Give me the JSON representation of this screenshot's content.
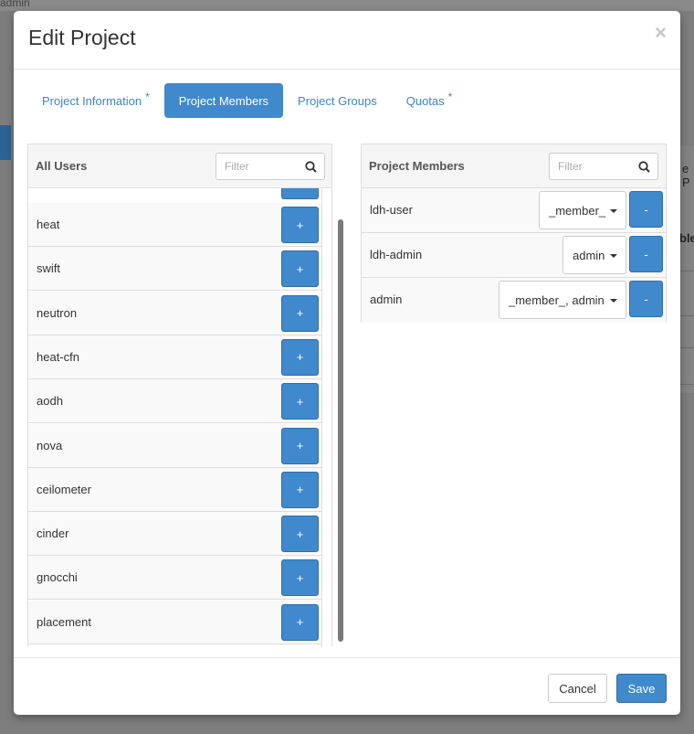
{
  "background": {
    "topbar_text": "admin",
    "right_text_1": "e P",
    "right_text_2": "ble"
  },
  "modal": {
    "title": "Edit Project",
    "close_glyph": "×"
  },
  "tabs": [
    {
      "label": "Project Information",
      "required": "*",
      "active": false
    },
    {
      "label": "Project Members",
      "required": "",
      "active": true
    },
    {
      "label": "Project Groups",
      "required": "",
      "active": false
    },
    {
      "label": "Quotas",
      "required": "*",
      "active": false
    }
  ],
  "all_users": {
    "title": "All Users",
    "filter_placeholder": "Filter",
    "add_label": "+",
    "users": [
      "heat",
      "swift",
      "neutron",
      "heat-cfn",
      "aodh",
      "nova",
      "ceilometer",
      "cinder",
      "gnocchi",
      "placement"
    ]
  },
  "project_members": {
    "title": "Project Members",
    "filter_placeholder": "Filter",
    "remove_label": "-",
    "members": [
      {
        "name": "ldh-user",
        "roles": "_member_"
      },
      {
        "name": "ldh-admin",
        "roles": "admin"
      },
      {
        "name": "admin",
        "roles": "_member_, admin"
      }
    ]
  },
  "footer": {
    "cancel_label": "Cancel",
    "save_label": "Save"
  },
  "colors": {
    "primary": "#3f89cc",
    "link": "#3a87c8"
  },
  "icons": {
    "close": "close-icon",
    "search": "search-icon",
    "caret": "caret-down-icon"
  }
}
